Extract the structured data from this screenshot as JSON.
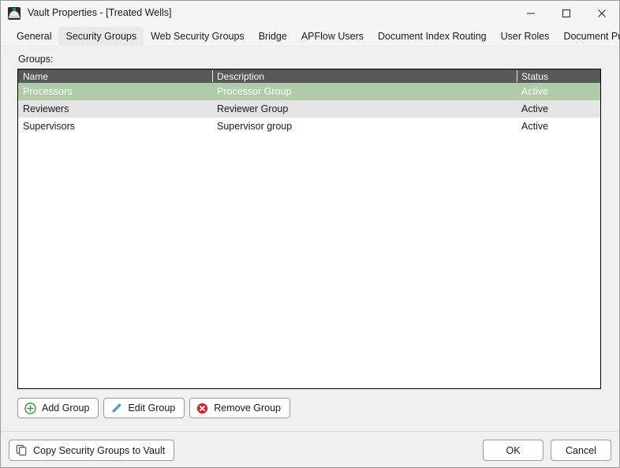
{
  "window": {
    "title": "Vault Properties - [Treated Wells]",
    "app_icon": "vault-app-icon",
    "controls": {
      "minimize": "minimize-icon",
      "maximize": "maximize-icon",
      "close": "close-icon"
    }
  },
  "tabs": [
    {
      "label": "General",
      "active": false
    },
    {
      "label": "Security Groups",
      "active": true
    },
    {
      "label": "Web Security Groups",
      "active": false
    },
    {
      "label": "Bridge",
      "active": false
    },
    {
      "label": "APFlow Users",
      "active": false
    },
    {
      "label": "Document Index Routing",
      "active": false
    },
    {
      "label": "User Roles",
      "active": false
    },
    {
      "label": "Document Publishing",
      "active": false
    }
  ],
  "main": {
    "groups_label": "Groups:",
    "columns": [
      {
        "key": "name",
        "label": "Name"
      },
      {
        "key": "description",
        "label": "Description"
      },
      {
        "key": "status",
        "label": "Status"
      }
    ],
    "rows": [
      {
        "name": "Processors",
        "description": "Processor Group",
        "status": "Active",
        "selected": true
      },
      {
        "name": "Reviewers",
        "description": "Reviewer Group",
        "status": "Active",
        "selected": false
      },
      {
        "name": "Supervisors",
        "description": "Supervisor group",
        "status": "Active",
        "selected": false
      }
    ]
  },
  "actions": {
    "add": "Add Group",
    "edit": "Edit Group",
    "remove": "Remove Group"
  },
  "footer": {
    "copy": "Copy Security Groups to Vault",
    "ok": "OK",
    "cancel": "Cancel"
  },
  "colors": {
    "header_row": "#58585a",
    "selected_row": "#b0cba8",
    "alt_row": "#e4e4e4",
    "window_bg": "#f0f0f0",
    "add_icon": "#3f9a4a",
    "edit_icon": "#3f9fd4",
    "remove_icon": "#d81f28",
    "copy_icon": "#4a5a72",
    "accent_green": "#14a038"
  }
}
